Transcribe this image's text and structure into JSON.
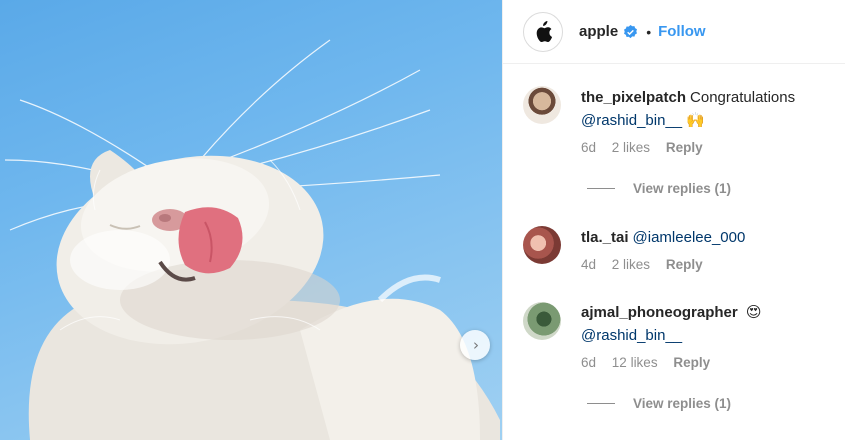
{
  "post": {
    "author": "apple",
    "separator": "•",
    "follow_label": "Follow",
    "verified_color": "#3897f0",
    "next_icon": "chevron-right-icon"
  },
  "comments": [
    {
      "user": "the_pixelpatch",
      "text": "Congratulations",
      "mention": "@rashid_bin__",
      "emoji": "🙌",
      "age": "6d",
      "likes": "2 likes",
      "reply": "Reply",
      "view_replies": "View replies (1)"
    },
    {
      "user": "tla._tai",
      "text": "",
      "mention": "@iamleelee_000",
      "emoji": "",
      "age": "4d",
      "likes": "2 likes",
      "reply": "Reply",
      "view_replies": ""
    },
    {
      "user": "ajmal_phoneographer",
      "text": "",
      "mention": "@rashid_bin__",
      "emoji": "😍",
      "age": "6d",
      "likes": "12 likes",
      "reply": "Reply",
      "view_replies": "View replies (1)"
    }
  ]
}
